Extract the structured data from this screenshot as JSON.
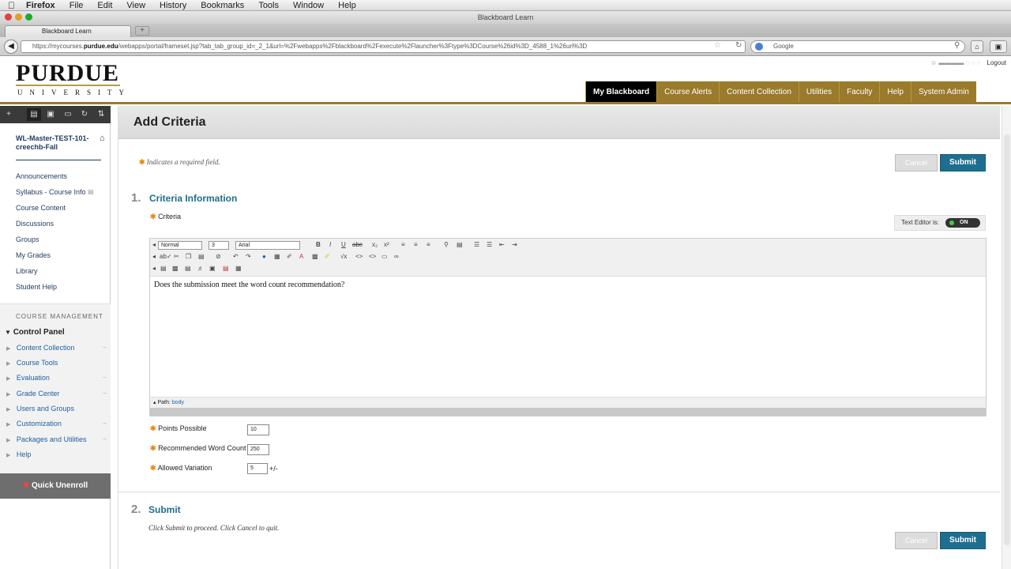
{
  "menubar": {
    "apple": "",
    "app": "Firefox",
    "items": [
      "File",
      "Edit",
      "View",
      "History",
      "Bookmarks",
      "Tools",
      "Window",
      "Help"
    ]
  },
  "window": {
    "title": "Blackboard Learn"
  },
  "browser": {
    "tab": "Blackboard Learn",
    "newtab": "+",
    "url_pre": "https://mycourses.",
    "url_host": "purdue.edu",
    "url_post": "/webapps/portal/frameset.jsp?tab_tab_group_id=_2_1&url=%2Fwebapps%2Fblackboard%2Fexecute%2Flauncher%3Ftype%3DCourse%26id%3D_4588_1%26url%3D",
    "search_placeholder": "Google"
  },
  "header": {
    "logo_main": "PURDUE",
    "logo_sub": "UNIVERSITY",
    "logout": "Logout",
    "tabs": [
      "My Blackboard",
      "Course Alerts",
      "Content Collection",
      "Utilities",
      "Faculty",
      "Help",
      "System Admin"
    ]
  },
  "sidebar": {
    "course": "WL-Master-TEST-101-creechb-Fall",
    "items": [
      "Announcements",
      "Syllabus - Course Info",
      "Course Content",
      "Discussions",
      "Groups",
      "My Grades",
      "Library",
      "Student Help"
    ],
    "mgmt_title": "COURSE MANAGEMENT",
    "control_panel": "Control Panel",
    "cp_items": [
      "Content Collection",
      "Course Tools",
      "Evaluation",
      "Grade Center",
      "Users and Groups",
      "Customization",
      "Packages and Utilities",
      "Help"
    ],
    "quick": "Quick Unenroll"
  },
  "page": {
    "title": "Add Criteria",
    "required_note": "Indicates a required field.",
    "cancel": "Cancel",
    "submit": "Submit",
    "sec1_num": "1.",
    "sec1_title": "Criteria Information",
    "criteria_label": "Criteria",
    "text_editor_label": "Text Editor is:",
    "toggle": "ON",
    "editor": {
      "format": "Normal",
      "size": "3",
      "font": "Arial",
      "content": "Does the submission meet the word count recommendation?",
      "path_label": "Path:",
      "path_value": "body"
    },
    "points_label": "Points Possible",
    "points_value": "10",
    "wordcount_label": "Recommended Word Count",
    "wordcount_value": "250",
    "variation_label": "Allowed Variation",
    "variation_value": "5",
    "variation_suffix": "+/-",
    "sec2_num": "2.",
    "sec2_title": "Submit",
    "submit_note": "Click Submit to proceed. Click Cancel to quit."
  }
}
